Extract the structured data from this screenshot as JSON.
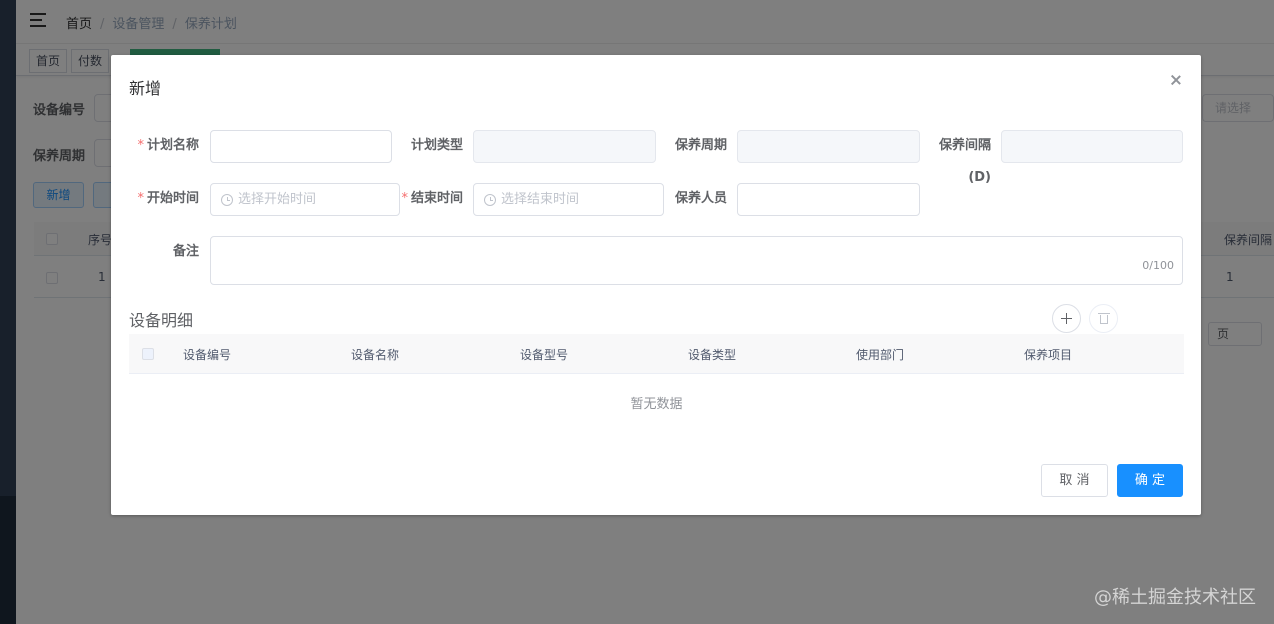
{
  "background": {
    "breadcrumb": [
      "首页",
      "设备管理",
      "保养计划"
    ],
    "tags": [
      "首页",
      "付数"
    ],
    "search_labels": {
      "device_code": "设备编号",
      "maintenance_cycle": "保养周期"
    },
    "right_select_placeholder": "请选择",
    "add_button": "新增",
    "table_headers": {
      "index": "序号",
      "interval": "保养间隔"
    },
    "table_row": {
      "index": "1",
      "interval": "1"
    },
    "page_size_select": "页"
  },
  "dialog": {
    "title": "新增",
    "fields": {
      "plan_name": {
        "label": "计划名称",
        "required": true,
        "value": ""
      },
      "plan_type": {
        "label": "计划类型",
        "value": ""
      },
      "cycle": {
        "label": "保养周期",
        "value": ""
      },
      "interval": {
        "label": "保养间隔(D)",
        "value": ""
      },
      "start_time": {
        "label": "开始时间",
        "required": true,
        "placeholder": "选择开始时间"
      },
      "end_time": {
        "label": "结束时间",
        "required": true,
        "placeholder": "选择结束时间"
      },
      "staff": {
        "label": "保养人员",
        "value": ""
      },
      "remark": {
        "label": "备注",
        "count": "0/100"
      }
    },
    "detail": {
      "title": "设备明细",
      "columns": [
        "设备编号",
        "设备名称",
        "设备型号",
        "设备类型",
        "使用部门",
        "保养项目"
      ],
      "empty_text": "暂无数据"
    },
    "buttons": {
      "cancel": "取 消",
      "confirm": "确 定"
    }
  },
  "watermark": "@稀土掘金技术社区"
}
